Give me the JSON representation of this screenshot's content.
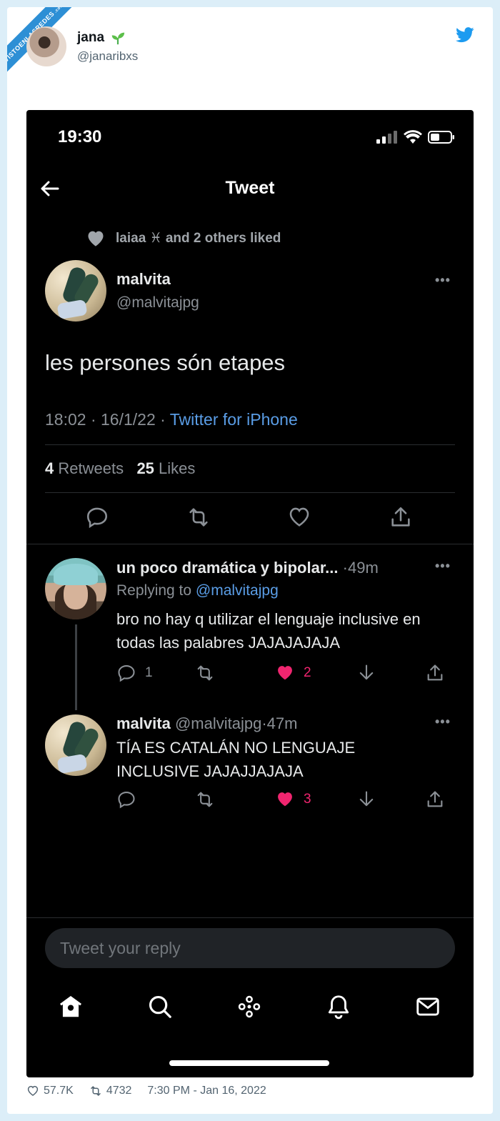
{
  "ribbon": {
    "text": "VISTOENLASREDES",
    "suffix": ".com"
  },
  "author": {
    "name": "jana",
    "handle": "@janaribxs"
  },
  "phone": {
    "time": "19:30",
    "nav_title": "Tweet",
    "liked_text": "laiaa ♓ and 2 others liked",
    "tweet": {
      "name": "malvita",
      "handle": "@malvitajpg",
      "text": "les persones són etapes",
      "time": "18:02 · 16/1/22 · ",
      "source": "Twitter for iPhone",
      "retweets_count": "4",
      "retweets_label": "Retweets",
      "likes_count": "25",
      "likes_label": "Likes"
    },
    "replies": [
      {
        "name": "un poco dramática y bipolar...",
        "meta": "·49m",
        "replying_prefix": "Replying to ",
        "replying_to": "@malvitajpg",
        "text": "bro no hay q utilizar el lenguaje inclusive en todas las palabres JAJAJAJAJA",
        "reply_count": "1",
        "like_count": "2"
      },
      {
        "name": "malvita",
        "meta": " @malvitajpg·47m",
        "text": "TÍA ES CATALÁN NO LENGUAJE INCLUSIVE JAJAJJAJAJA",
        "like_count": "3"
      }
    ],
    "reply_placeholder": "Tweet your reply"
  },
  "footer": {
    "likes": "57.7K",
    "retweets": "4732",
    "timestamp": "7:30 PM - Jan 16, 2022"
  },
  "colors": {
    "like_pink": "#f0256f",
    "link_blue": "#5a9de6",
    "twitter_blue": "#1d9bf0"
  }
}
